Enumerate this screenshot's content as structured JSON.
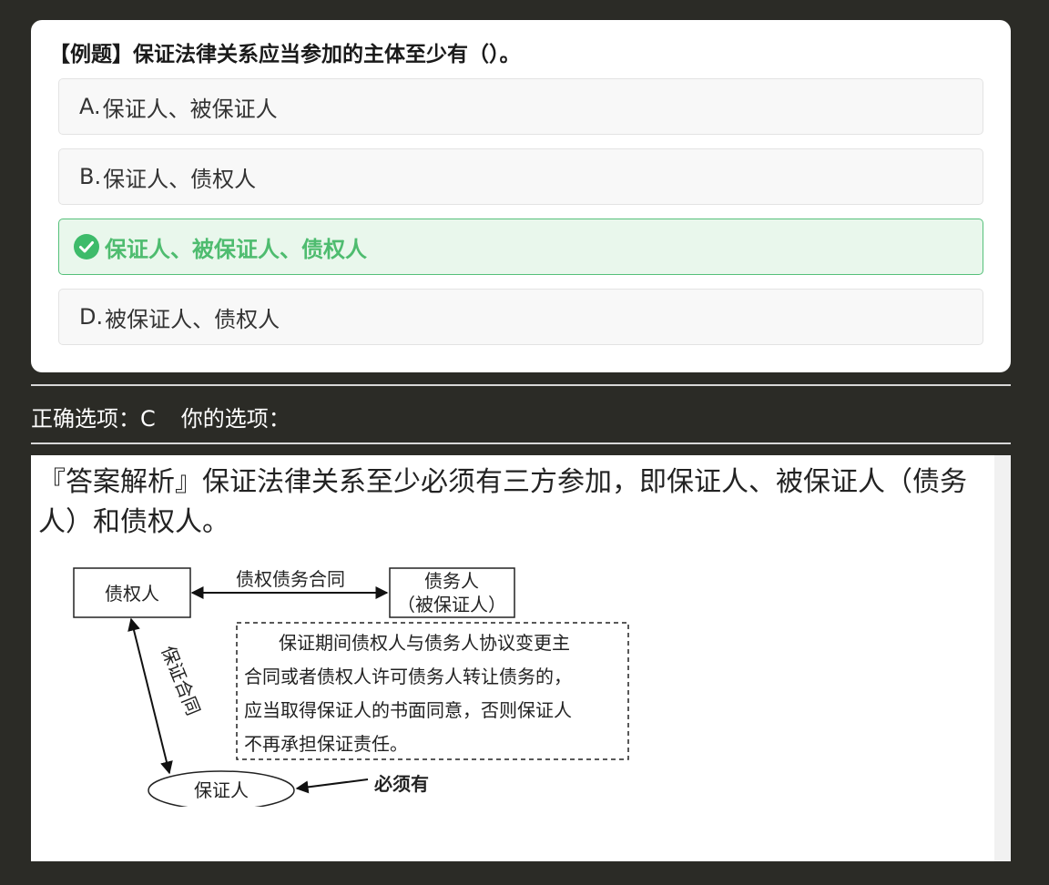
{
  "question": {
    "title": "【例题】保证法律关系应当参加的主体至少有（）。",
    "options": [
      {
        "letter": "A.",
        "text": "保证人、被保证人",
        "correct": false
      },
      {
        "letter": "B.",
        "text": "保证人、债权人",
        "correct": false
      },
      {
        "letter": "",
        "text": "保证人、被保证人、债权人",
        "correct": true,
        "icon": "check-circle-icon"
      },
      {
        "letter": "D.",
        "text": "被保证人、债权人",
        "correct": false
      }
    ]
  },
  "answer": {
    "correct_label": "正确选项：",
    "correct_value": "C",
    "yours_label": "你的选项：",
    "yours_value": ""
  },
  "analysis": {
    "text": "『答案解析』保证法律关系至少必须有三方参加，即保证人、被保证人（债务人）和债权人。",
    "diagram": {
      "creditor": "债权人",
      "contract_main": "债权债务合同",
      "debtor_line1": "债务人",
      "debtor_line2": "（被保证人）",
      "guarantee_contract": "保证合同",
      "guarantor": "保证人",
      "must_have": "必须有",
      "note_lines": [
        "保证期间债权人与债务人协议变更主",
        "合同或者债权人许可债务人转让债务的，",
        "应当取得保证人的书面同意，否则保证人",
        "不再承担保证责任。"
      ]
    }
  },
  "colors": {
    "background": "#2b2b26",
    "correct_green": "#4ebc6f",
    "correct_bg": "#e9f7ec"
  }
}
